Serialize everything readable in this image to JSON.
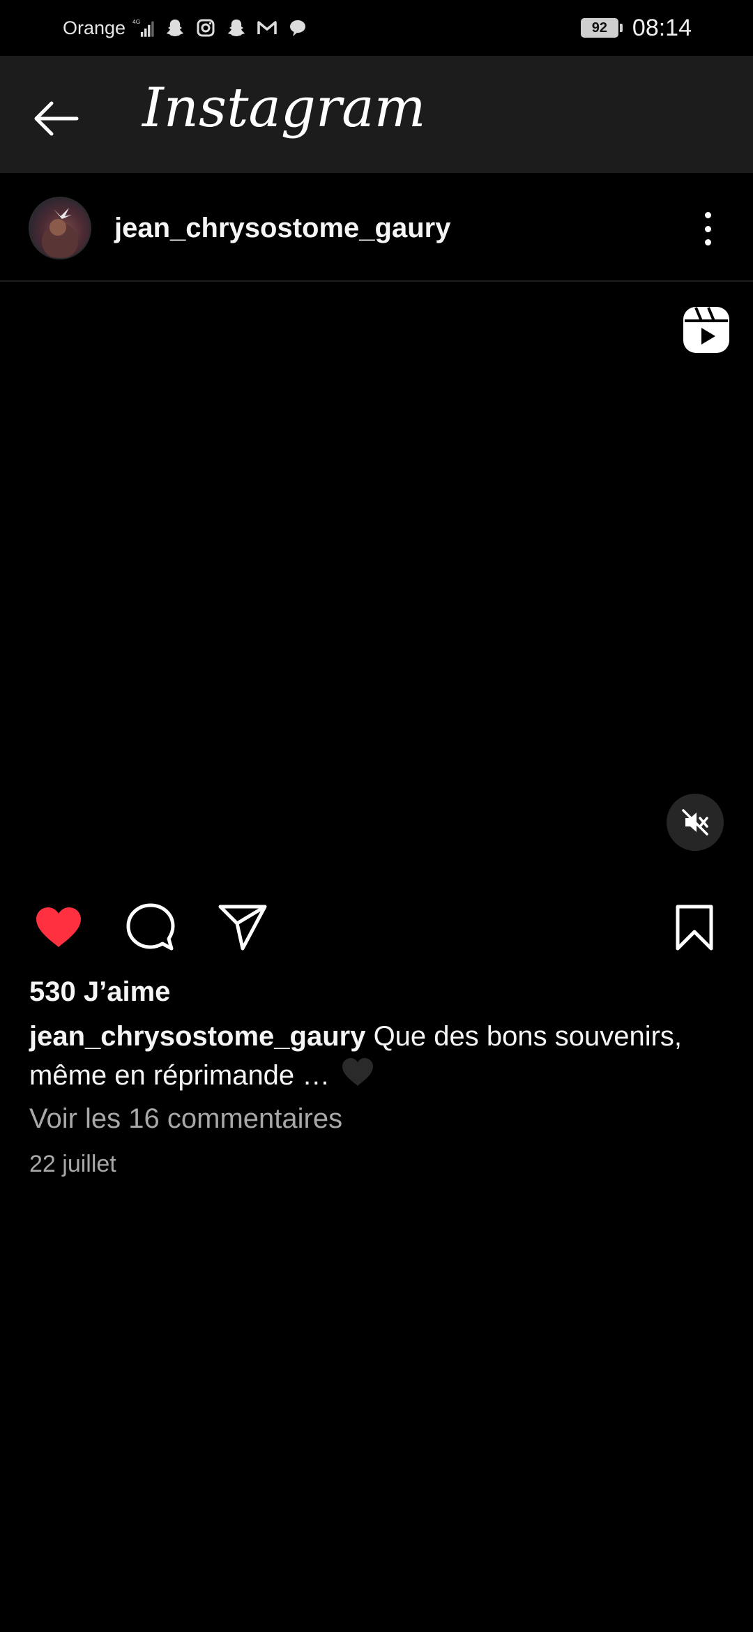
{
  "status_bar": {
    "carrier": "Orange",
    "network": "4G",
    "battery": "92",
    "time": "08:14",
    "icons": [
      "signal-icon",
      "snapchat-icon",
      "instagram-icon",
      "snapchat-icon",
      "gmail-icon",
      "chat-bubble-icon"
    ]
  },
  "app_bar": {
    "title": "Instagram",
    "back_icon": "arrow-left-icon"
  },
  "post": {
    "username": "jean_chrysostome_gaury",
    "more_icon": "more-vertical-icon",
    "media": {
      "type_icon": "reels-icon",
      "mute_icon": "volume-muted-icon"
    },
    "actions": {
      "like_icon": "heart-filled-icon",
      "comment_icon": "comment-icon",
      "share_icon": "send-icon",
      "save_icon": "bookmark-icon",
      "liked": true
    },
    "likes": "530 J’aime",
    "caption_user": "jean_chrysostome_gaury",
    "caption_text": " Que des bons souvenirs, même en réprimande … ",
    "view_comments": "Voir les 16 commentaires",
    "date": "22 juillet"
  },
  "colors": {
    "background": "#000000",
    "app_bar": "#1c1c1c",
    "like_red": "#ff3040",
    "muted_text": "#a8a8a8"
  }
}
